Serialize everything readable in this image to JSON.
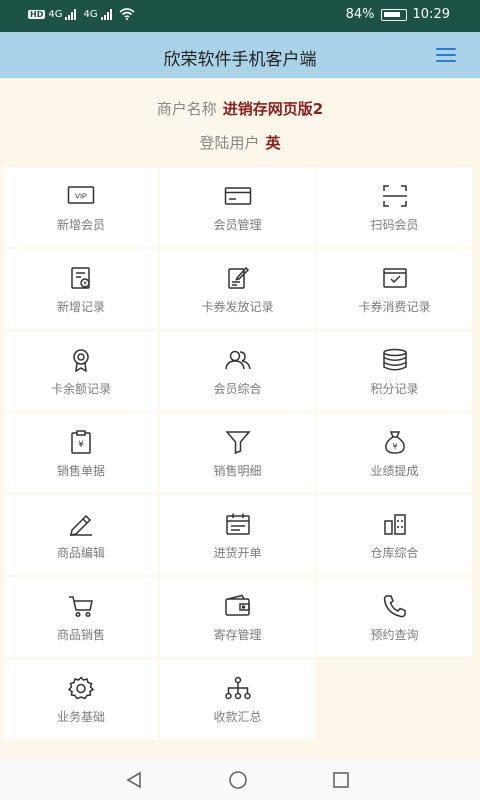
{
  "status_bar": {
    "badge": "HD",
    "network1": "4G",
    "network2": "4G",
    "battery": "84%",
    "time": "10:29"
  },
  "header": {
    "title": "欣荣软件手机客户端",
    "menu_icon": "hamburger-menu-icon",
    "accent_color": "#2a7ad6",
    "background": "#a9d4e8"
  },
  "merchant": {
    "label": "商户名称",
    "value": "进销存网页版2"
  },
  "user": {
    "label": "登陆用户",
    "value": "英"
  },
  "menu_items": [
    {
      "label": "新增会员",
      "icon": "vip-card-icon"
    },
    {
      "label": "会员管理",
      "icon": "card-icon"
    },
    {
      "label": "扫码会员",
      "icon": "scan-icon"
    },
    {
      "label": "新增记录",
      "icon": "record-icon"
    },
    {
      "label": "卡券发放记录",
      "icon": "edit-doc-icon"
    },
    {
      "label": "卡券消费记录",
      "icon": "check-doc-icon"
    },
    {
      "label": "卡余额记录",
      "icon": "badge-icon"
    },
    {
      "label": "会员综合",
      "icon": "users-icon"
    },
    {
      "label": "积分记录",
      "icon": "coins-stack-icon"
    },
    {
      "label": "销售单据",
      "icon": "yuan-clipboard-icon"
    },
    {
      "label": "销售明细",
      "icon": "filter-icon"
    },
    {
      "label": "业绩提成",
      "icon": "money-bag-icon"
    },
    {
      "label": "商品编辑",
      "icon": "pen-icon"
    },
    {
      "label": "进货开单",
      "icon": "calendar-icon"
    },
    {
      "label": "仓库综合",
      "icon": "buildings-icon"
    },
    {
      "label": "商品销售",
      "icon": "cart-icon"
    },
    {
      "label": "寄存管理",
      "icon": "wallet-icon"
    },
    {
      "label": "预约查询",
      "icon": "phone-icon"
    },
    {
      "label": "业务基础",
      "icon": "gear-icon"
    },
    {
      "label": "收款汇总",
      "icon": "hierarchy-icon"
    }
  ],
  "nav_bar": {
    "back_icon": "back-triangle-icon",
    "home_icon": "home-circle-icon",
    "recents_icon": "recents-square-icon"
  }
}
